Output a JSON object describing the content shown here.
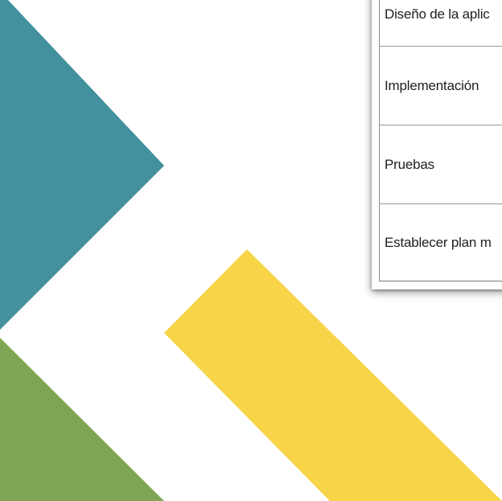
{
  "colors": {
    "teal": "#43909f",
    "green": "#7ea554",
    "yellow": "#f7d448",
    "background": "#ffffff"
  },
  "table": {
    "rows": [
      {
        "label": "Diseño de la aplic"
      },
      {
        "label": "Implementación"
      },
      {
        "label": "Pruebas"
      },
      {
        "label": "Establecer plan m"
      }
    ]
  }
}
